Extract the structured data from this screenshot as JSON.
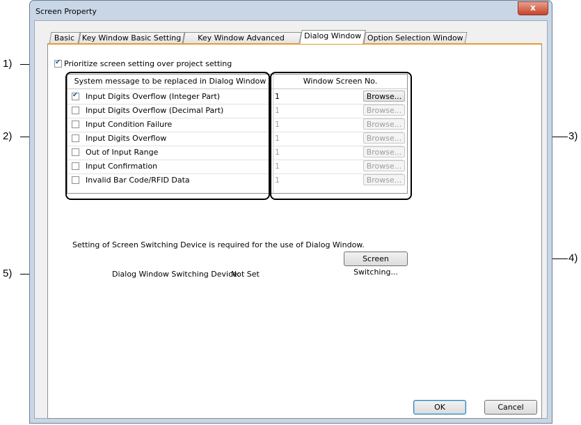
{
  "window": {
    "title": "Screen Property",
    "close_label": "x"
  },
  "tabs": [
    {
      "label": "Basic"
    },
    {
      "label": "Key Window Basic Setting"
    },
    {
      "label": "Key Window Advanced Setting"
    },
    {
      "label": "Dialog Window",
      "active": true
    },
    {
      "label": "Option Selection Window"
    }
  ],
  "prioritize": {
    "label": "Prioritize screen setting over project setting",
    "checked": true
  },
  "table": {
    "col_message": "System message to be replaced in Dialog Window",
    "col_screen": "Window Screen No.",
    "browse_label": "Browse...",
    "rows": [
      {
        "label": "Input Digits Overflow (Integer Part)",
        "checked": true,
        "screen": "1",
        "enabled": true
      },
      {
        "label": "Input Digits Overflow (Decimal Part)",
        "checked": false,
        "screen": "1",
        "enabled": false
      },
      {
        "label": "Input Condition Failure",
        "checked": false,
        "screen": "1",
        "enabled": false
      },
      {
        "label": "Input Digits Overflow",
        "checked": false,
        "screen": "1",
        "enabled": false
      },
      {
        "label": "Out of Input Range",
        "checked": false,
        "screen": "1",
        "enabled": false
      },
      {
        "label": "Input Confirmation",
        "checked": false,
        "screen": "1",
        "enabled": false
      },
      {
        "label": "Invalid Bar Code/RFID Data",
        "checked": false,
        "screen": "1",
        "enabled": false
      }
    ]
  },
  "switching": {
    "note": "Setting of Screen Switching Device is required for the use of Dialog Window.",
    "button_label": "Screen Switching...",
    "device_label": "Dialog Window Switching Device:",
    "device_value": "Not Set"
  },
  "footer": {
    "ok_label": "OK",
    "cancel_label": "Cancel"
  },
  "annotations": {
    "a1": "1)",
    "a2": "2)",
    "a3": "3)",
    "a4": "4)",
    "a5": "5)"
  },
  "colors": {
    "accent_tab": "#e89b2b",
    "frame": "#c8d6e6",
    "close": "#c7432b"
  }
}
